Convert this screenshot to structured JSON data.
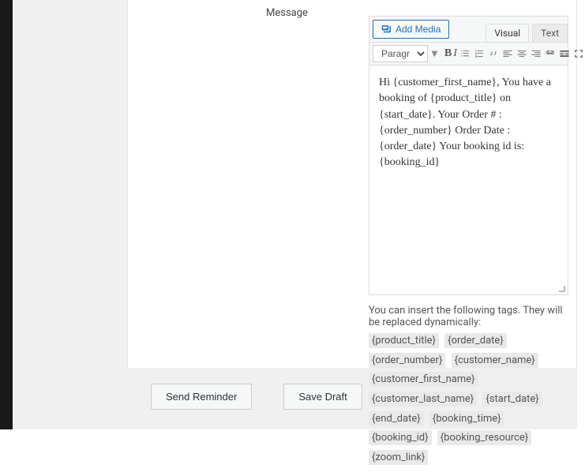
{
  "form": {
    "message_label": "Message"
  },
  "editor": {
    "add_media_label": "Add Media",
    "tab_visual": "Visual",
    "tab_text": "Text",
    "format_select": "Paragraph",
    "content": "Hi {customer_first_name}, You have a booking of {product_title} on {start_date}. Your Order # : {order_number} Order Date : {order_date} Your booking id is: {booking_id}"
  },
  "tags_help": {
    "intro": "You can insert the following tags. They will be replaced dynamically:",
    "tags": [
      "{product_title}",
      "{order_date}",
      "{order_number}",
      "{customer_name}",
      "{customer_first_name}",
      "{customer_last_name}",
      "{start_date}",
      "{end_date}",
      "{booking_time}",
      "{booking_id}",
      "{booking_resource}",
      "{zoom_link}"
    ]
  },
  "buttons": {
    "send_reminder": "Send Reminder",
    "save_draft": "Save Draft"
  }
}
